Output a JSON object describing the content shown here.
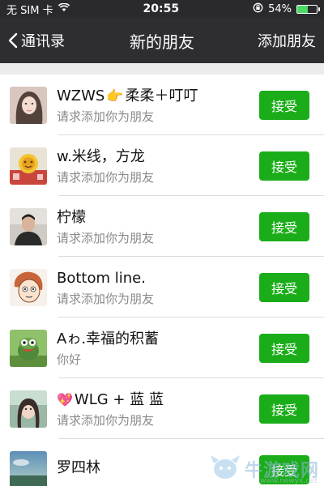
{
  "status_bar": {
    "carrier": "无 SIM 卡",
    "time": "20:55",
    "battery_percent": "54%",
    "battery_level": 0.54
  },
  "nav": {
    "back_label": "通讯录",
    "title": "新的朋友",
    "action_label": "添加朋友"
  },
  "requests": [
    {
      "name_before_icon": "WZWS",
      "name_icon": "pointing-hand-icon",
      "name_after_icon": "柔柔＋叮叮",
      "message": "请求添加你为朋友",
      "button": "接受"
    },
    {
      "name_before_icon": "w.米线，方龙",
      "name_icon": "",
      "name_after_icon": "",
      "message": "请求添加你为朋友",
      "button": "接受"
    },
    {
      "name_before_icon": "柠檬",
      "name_icon": "",
      "name_after_icon": "",
      "message": "请求添加你为朋友",
      "button": "接受"
    },
    {
      "name_before_icon": "Bottom line.",
      "name_icon": "",
      "name_after_icon": "",
      "message": "请求添加你为朋友",
      "button": "接受"
    },
    {
      "name_before_icon": "Aゎ.幸福的积蓄",
      "name_icon": "",
      "name_after_icon": "",
      "message": "你好",
      "button": "接受"
    },
    {
      "name_before_icon": "",
      "name_icon": "sparkling-heart-icon",
      "name_after_icon": "WLG + 蓝 蓝",
      "message": "请求添加你为朋友",
      "button": "接受"
    },
    {
      "name_before_icon": "罗四林",
      "name_icon": "",
      "name_after_icon": "",
      "message": "",
      "button": "接受"
    }
  ],
  "watermark": {
    "text": "牛游戏网",
    "url": "www.newyx.net"
  },
  "colors": {
    "accept_green": "#1aad19",
    "nav_background": "#2e2e32"
  }
}
